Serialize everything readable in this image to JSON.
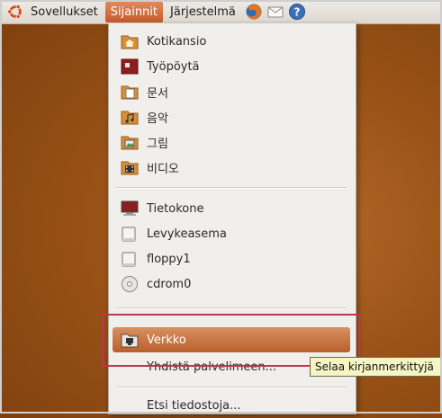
{
  "panel": {
    "menus": [
      {
        "label": "Sovellukset"
      },
      {
        "label": "Sijainnit"
      },
      {
        "label": "Järjestelmä"
      }
    ],
    "launchers": [
      "firefox-icon",
      "mail-icon",
      "help-icon"
    ]
  },
  "places_menu": {
    "folders": [
      {
        "label": "Kotikansio",
        "icon": "home-folder-icon"
      },
      {
        "label": "Työpöytä",
        "icon": "desktop-icon"
      },
      {
        "label": "문서",
        "icon": "documents-folder-icon"
      },
      {
        "label": "음악",
        "icon": "music-folder-icon"
      },
      {
        "label": "그림",
        "icon": "pictures-folder-icon"
      },
      {
        "label": "비디오",
        "icon": "videos-folder-icon"
      }
    ],
    "devices": [
      {
        "label": "Tietokone",
        "icon": "computer-icon"
      },
      {
        "label": "Levykeasema",
        "icon": "drive-icon"
      },
      {
        "label": "floppy1",
        "icon": "floppy-icon"
      },
      {
        "label": "cdrom0",
        "icon": "cdrom-icon"
      }
    ],
    "network": {
      "label": "Verkko",
      "icon": "network-folder-icon"
    },
    "connect": {
      "label": "Yhdistä palvelimeen..."
    },
    "search": {
      "label": "Etsi tiedostoja..."
    }
  },
  "tooltip": {
    "text": "Selaa kirjanmerkittyjä"
  },
  "colors": {
    "accent": "#c6592a",
    "annotation": "#c2344e",
    "tooltip_bg": "#f6f5c4"
  }
}
